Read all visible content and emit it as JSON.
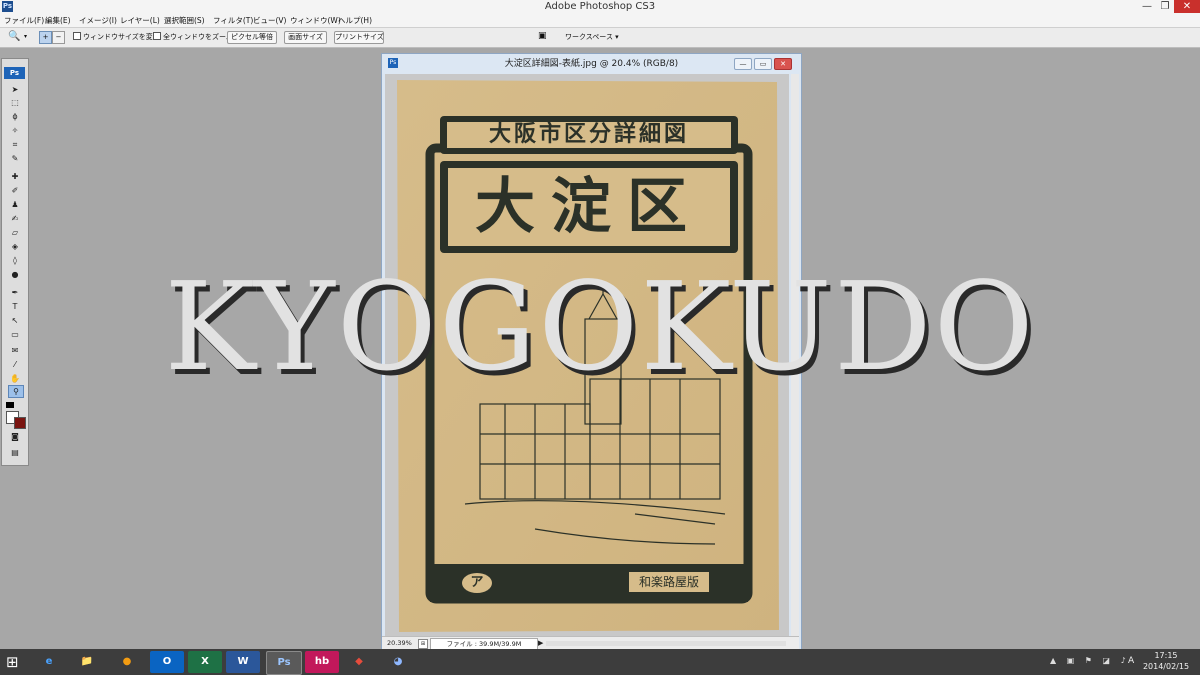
{
  "window": {
    "app_title": "Adobe Photoshop CS3",
    "minimize": "—",
    "maximize": "❐",
    "close": "✕"
  },
  "menu": [
    "ファイル(F)",
    "編集(E)",
    "イメージ(I)",
    "レイヤー(L)",
    "選択範囲(S)",
    "フィルタ(T)",
    "ビュー(V)",
    "ウィンドウ(W)",
    "ヘルプ(H)"
  ],
  "options_bar": {
    "resize_windows_label": "ウィンドウサイズを変更",
    "zoom_all_windows_label": "全ウィンドウをズーム",
    "actual_pixels_button": "ピクセル等倍",
    "fit_screen_button": "画面サイズ",
    "print_size_button": "プリントサイズ",
    "workspace_label": "ワークスペース ▾"
  },
  "document": {
    "title": "大淀区詳細図-表紙.jpg @ 20.4% (RGB/8)",
    "zoom_level": "20.39%",
    "file_size": "ファイル : 39.9M/39.9M",
    "cover": {
      "top_title": "大阪市区分詳細図",
      "district": "大淀区",
      "publisher_logo": "ア",
      "publisher": "和楽路屋版"
    }
  },
  "watermark": "KYOGOKUDO",
  "taskbar": {
    "apps": [
      "e",
      "📁",
      "●",
      "O",
      "X",
      "W",
      "Ps",
      "hb",
      "◆",
      "◕"
    ],
    "active_app_index": 6,
    "time": "17:15",
    "date": "2014/02/15",
    "ime": "A"
  },
  "colors": {
    "paper": "#d9c08f",
    "ink": "#2b3128",
    "ps_blue": "#1e64b8"
  }
}
